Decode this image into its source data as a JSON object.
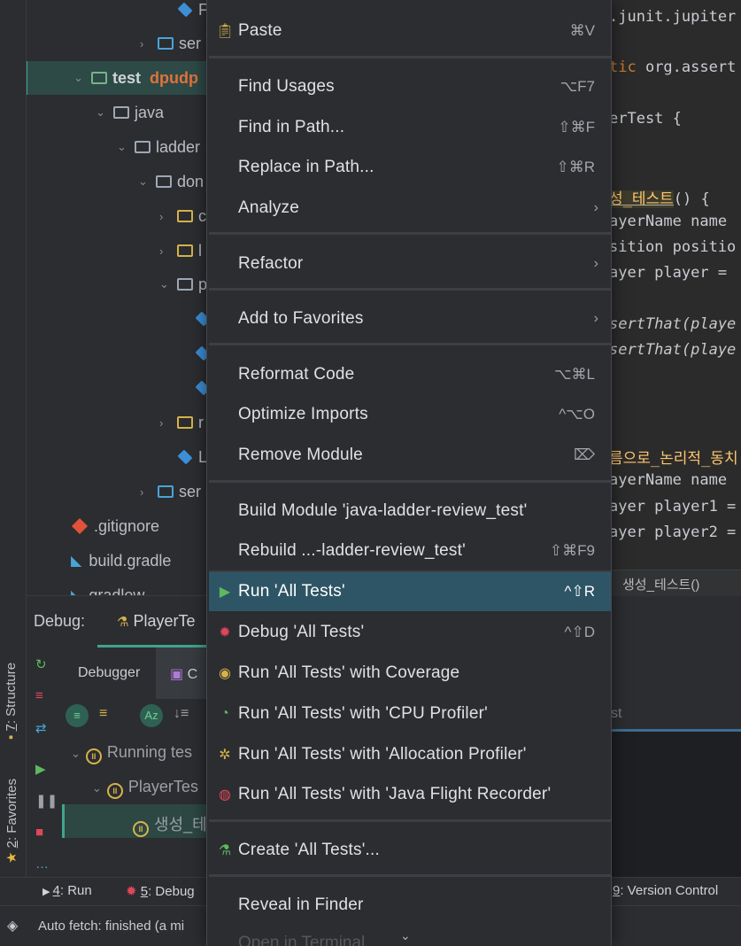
{
  "editor": {
    "lines": [
      {
        "text": ".junit.jupiter",
        "style": "plain"
      },
      {
        "prefix": "tic",
        "text": " org.assert",
        "style": "kw"
      },
      {
        "text": "erTest {",
        "style": "plain"
      },
      {
        "hl": "성_테스트",
        "text": "() {",
        "style": "hl"
      },
      {
        "text": "ayerName name",
        "style": "plain"
      },
      {
        "text": "sition positio",
        "style": "plain"
      },
      {
        "text": "ayer player =",
        "style": "plain"
      },
      {
        "text": "sertThat(playe",
        "style": "it"
      },
      {
        "text": "sertThat(playe",
        "style": "it"
      },
      {
        "text": "름으로_논리적_동치",
        "style": "fn"
      },
      {
        "text": "ayerName name",
        "style": "plain"
      },
      {
        "text": "ayer player1 =",
        "style": "plain"
      },
      {
        "text": "ayer player2 =",
        "style": "plain"
      }
    ],
    "breadcrumb": "생성_테스트()"
  },
  "tree": {
    "rows": [
      {
        "label": "F",
        "type": "class"
      },
      {
        "label": "ser",
        "type": "src-folder"
      },
      {
        "label": "test",
        "extra": "dpudp",
        "type": "test-folder"
      },
      {
        "label": "java",
        "type": "folder"
      },
      {
        "label": "ladder",
        "type": "folder"
      },
      {
        "label": "don",
        "type": "folder"
      },
      {
        "label": "c",
        "type": "package"
      },
      {
        "label": "l",
        "type": "package"
      },
      {
        "label": "p",
        "type": "package"
      },
      {
        "label": "",
        "type": "class"
      },
      {
        "label": "",
        "type": "class"
      },
      {
        "label": "",
        "type": "class"
      },
      {
        "label": "r",
        "type": "package"
      },
      {
        "label": "L",
        "type": "class"
      },
      {
        "label": "ser",
        "type": "src-folder"
      },
      {
        "label": ".gitignore",
        "type": "git"
      },
      {
        "label": "build.gradle",
        "type": "gradle"
      },
      {
        "label": "gradlew",
        "type": "gradle"
      }
    ]
  },
  "left_strip": {
    "structure": {
      "num": "7",
      "label": ": Structure"
    },
    "favorites": {
      "num": "2",
      "label": ": Favorites"
    }
  },
  "debug": {
    "title": "Debug:",
    "tab": "PlayerTe",
    "subtabs": {
      "debugger": "Debugger",
      "console": "C"
    },
    "tests": [
      {
        "label": "Running tes"
      },
      {
        "label": "PlayerTes"
      },
      {
        "label": "생성_테"
      }
    ],
    "right_tab": "st"
  },
  "bottom_tabs": {
    "run": {
      "num": "4",
      "label": ": Run"
    },
    "debug": {
      "num": "5",
      "label": ": Debug"
    },
    "vcs": {
      "num": "9",
      "label": ": Version Control"
    }
  },
  "status": {
    "text": "Auto fetch: finished (a mi"
  },
  "menu": {
    "items": [
      {
        "label": "Paste",
        "shortcut": "⌘V",
        "icon": "clipboard-icon"
      },
      {
        "label": "Find Usages",
        "shortcut": "⌥F7"
      },
      {
        "label": "Find in Path...",
        "shortcut": "⇧⌘F"
      },
      {
        "label": "Replace in Path...",
        "shortcut": "⇧⌘R"
      },
      {
        "label": "Analyze",
        "submenu": true
      },
      {
        "label": "Refactor",
        "submenu": true
      },
      {
        "label": "Add to Favorites",
        "submenu": true
      },
      {
        "label": "Reformat Code",
        "shortcut": "⌥⌘L"
      },
      {
        "label": "Optimize Imports",
        "shortcut": "^⌥O"
      },
      {
        "label": "Remove Module",
        "shortcut": "⌦"
      },
      {
        "label": "Build Module 'java-ladder-review_test'"
      },
      {
        "label": "Rebuild ...-ladder-review_test'",
        "shortcut": "⇧⌘F9"
      },
      {
        "label": "Run 'All Tests'",
        "shortcut": "^⇧R",
        "icon": "run-icon",
        "active": true
      },
      {
        "label": "Debug 'All Tests'",
        "shortcut": "^⇧D",
        "icon": "debug-icon"
      },
      {
        "label": "Run 'All Tests' with Coverage",
        "icon": "coverage-icon"
      },
      {
        "label": "Run 'All Tests' with 'CPU Profiler'",
        "icon": "cpu-profiler-icon"
      },
      {
        "label": "Run 'All Tests' with 'Allocation Profiler'",
        "icon": "allocation-profiler-icon"
      },
      {
        "label": "Run 'All Tests' with 'Java Flight Recorder'",
        "icon": "flight-recorder-icon"
      },
      {
        "label": "Create 'All Tests'...",
        "icon": "test-tube-icon"
      },
      {
        "label": "Reveal in Finder"
      },
      {
        "label": "Open in Terminal"
      }
    ]
  },
  "colors": {
    "menu_bg": "#2b2d30",
    "active_item": "#2e5565",
    "run_green": "#5fb85f",
    "debug_red": "#e0475a",
    "accent_teal": "#3fa590"
  }
}
